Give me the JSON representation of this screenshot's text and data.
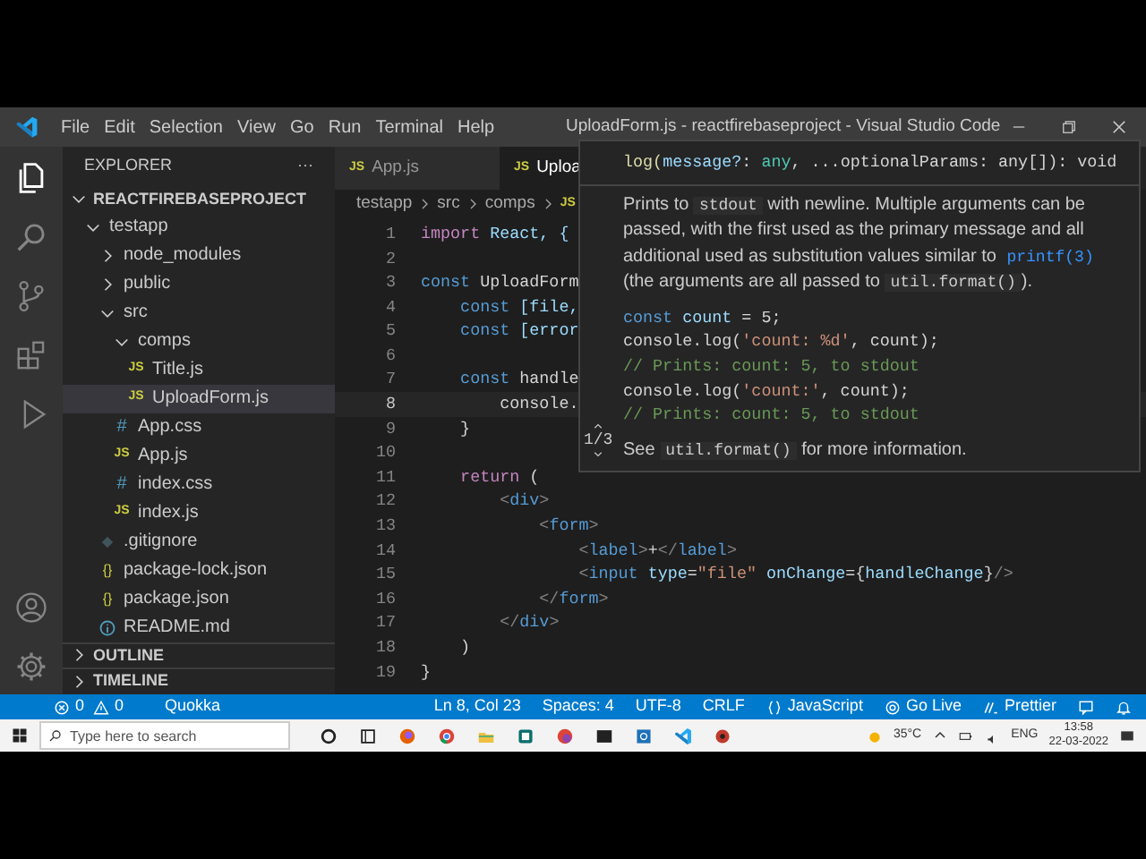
{
  "window": {
    "title": "UploadForm.js - reactfirebaseproject - Visual Studio Code"
  },
  "menu": [
    "File",
    "Edit",
    "Selection",
    "View",
    "Go",
    "Run",
    "Terminal",
    "Help"
  ],
  "activity_bar": [
    {
      "kind": "files",
      "selected": true
    },
    {
      "kind": "search",
      "selected": false
    },
    {
      "kind": "scm",
      "selected": false
    },
    {
      "kind": "extensions",
      "selected": false
    },
    {
      "kind": "run",
      "selected": false
    }
  ],
  "activity_bottom": [
    {
      "kind": "account"
    },
    {
      "kind": "settings"
    }
  ],
  "sidebar": {
    "title": "EXPLORER",
    "more": "···",
    "project": "REACTFIREBASEPROJECT",
    "tree": [
      {
        "label": "testapp",
        "kind": "folder",
        "expanded": true,
        "selected": false,
        "children": [
          {
            "label": "node_modules",
            "kind": "folder",
            "expanded": false,
            "selected": false
          },
          {
            "label": "public",
            "kind": "folder",
            "expanded": false,
            "selected": false
          },
          {
            "label": "src",
            "kind": "folder",
            "expanded": true,
            "selected": false,
            "children": [
              {
                "label": "comps",
                "kind": "folder",
                "expanded": true,
                "selected": false,
                "children": [
                  {
                    "label": "Title.js",
                    "kind": "js",
                    "icon_text": "JS",
                    "selected": false
                  },
                  {
                    "label": "UploadForm.js",
                    "kind": "js",
                    "icon_text": "JS",
                    "selected": true
                  }
                ]
              },
              {
                "label": "App.css",
                "kind": "css",
                "icon_text": "#",
                "selected": false
              },
              {
                "label": "App.js",
                "kind": "js",
                "icon_text": "JS",
                "selected": false
              },
              {
                "label": "index.css",
                "kind": "css",
                "icon_text": "#",
                "selected": false
              },
              {
                "label": "index.js",
                "kind": "js",
                "icon_text": "JS",
                "selected": false
              }
            ]
          },
          {
            "label": ".gitignore",
            "kind": "git",
            "selected": false
          },
          {
            "label": "package-lock.json",
            "kind": "json",
            "icon_text": "{}",
            "selected": false
          },
          {
            "label": "package.json",
            "kind": "json",
            "icon_text": "{}",
            "selected": false
          },
          {
            "label": "README.md",
            "kind": "info",
            "selected": false
          }
        ]
      }
    ],
    "sections": [
      {
        "label": "OUTLINE",
        "expanded": false
      },
      {
        "label": "TIMELINE",
        "expanded": false
      }
    ]
  },
  "tabs": [
    {
      "label": "App.js",
      "icon_text": "JS",
      "selected": false
    },
    {
      "label": "Uploa",
      "icon_text": "JS",
      "selected": true
    }
  ],
  "breadcrumb": [
    "testapp",
    "src",
    "comps"
  ],
  "breadcrumb_icon": "JS",
  "code_lines": [
    {
      "number": "1",
      "current": false,
      "tokens": [
        {
          "kind": "ctrl",
          "text": "import"
        },
        {
          "kind": "var",
          "text": " React, {"
        }
      ]
    },
    {
      "number": "2",
      "current": false
    },
    {
      "number": "3",
      "current": false,
      "tokens": [
        {
          "kind": "kw",
          "text": "const"
        },
        {
          "kind": "plain",
          "text": " UploadForm"
        }
      ]
    },
    {
      "number": "4",
      "current": false,
      "tokens": [
        {
          "kind": "kw",
          "text": "    const"
        },
        {
          "kind": "var",
          "text": " [file,"
        }
      ]
    },
    {
      "number": "5",
      "current": false,
      "tokens": [
        {
          "kind": "kw",
          "text": "    const"
        },
        {
          "kind": "var",
          "text": " [error"
        }
      ]
    },
    {
      "number": "6",
      "current": false
    },
    {
      "number": "7",
      "current": false,
      "tokens": [
        {
          "kind": "kw",
          "text": "    const"
        },
        {
          "kind": "plain",
          "text": " handle"
        }
      ]
    },
    {
      "number": "8",
      "current": true,
      "tokens": [
        {
          "kind": "plain",
          "text": "        console."
        }
      ]
    },
    {
      "number": "9",
      "current": false,
      "tokens": [
        {
          "kind": "plain",
          "text": "    }"
        }
      ]
    },
    {
      "number": "10",
      "current": false
    },
    {
      "number": "11",
      "current": false,
      "tokens": [
        {
          "kind": "ctrl",
          "text": "    return"
        },
        {
          "kind": "plain",
          "text": " ("
        }
      ]
    },
    {
      "number": "12",
      "current": false,
      "tokens": [
        {
          "kind": "punct",
          "text": "        <"
        },
        {
          "kind": "tag",
          "text": "div"
        },
        {
          "kind": "punct",
          "text": ">"
        }
      ]
    },
    {
      "number": "13",
      "current": false,
      "tokens": [
        {
          "kind": "punct",
          "text": "            <"
        },
        {
          "kind": "tag",
          "text": "form"
        },
        {
          "kind": "punct",
          "text": ">"
        }
      ]
    },
    {
      "number": "14",
      "current": false,
      "tokens": [
        {
          "kind": "punct",
          "text": "                <"
        },
        {
          "kind": "tag",
          "text": "label"
        },
        {
          "kind": "punct",
          "text": ">"
        },
        {
          "kind": "plain",
          "text": "+"
        },
        {
          "kind": "punct",
          "text": "</"
        },
        {
          "kind": "tag",
          "text": "label"
        },
        {
          "kind": "punct",
          "text": ">"
        }
      ]
    },
    {
      "number": "15",
      "current": false,
      "tokens": [
        {
          "kind": "punct",
          "text": "                <"
        },
        {
          "kind": "tag",
          "text": "input"
        },
        {
          "kind": "var",
          "text": " type"
        },
        {
          "kind": "plain",
          "text": "="
        },
        {
          "kind": "str",
          "text": "\"file\""
        },
        {
          "kind": "var",
          "text": " onChange"
        },
        {
          "kind": "plain",
          "text": "={"
        },
        {
          "kind": "var",
          "text": "handleChange"
        },
        {
          "kind": "plain",
          "text": "}"
        },
        {
          "kind": "punct",
          "text": "/>"
        }
      ]
    },
    {
      "number": "16",
      "current": false,
      "tokens": [
        {
          "kind": "punct",
          "text": "            </"
        },
        {
          "kind": "tag",
          "text": "form"
        },
        {
          "kind": "punct",
          "text": ">"
        }
      ]
    },
    {
      "number": "17",
      "current": false,
      "tokens": [
        {
          "kind": "punct",
          "text": "        </"
        },
        {
          "kind": "tag",
          "text": "div"
        },
        {
          "kind": "punct",
          "text": ">"
        }
      ]
    },
    {
      "number": "18",
      "current": false,
      "tokens": [
        {
          "kind": "plain",
          "text": "    )"
        }
      ]
    },
    {
      "number": "19",
      "current": false,
      "tokens": [
        {
          "kind": "plain",
          "text": "}"
        }
      ]
    }
  ],
  "hover": {
    "signature": [
      {
        "kind": "func",
        "text": "log("
      },
      {
        "kind": "param",
        "text": "message?"
      },
      {
        "kind": "plain",
        "text": ": "
      },
      {
        "kind": "type",
        "text": "any"
      },
      {
        "kind": "plain",
        "text": ", ...optionalParams: any[]): void"
      }
    ],
    "description": [
      {
        "kind": "text",
        "text": "Prints to "
      },
      {
        "kind": "code",
        "text": "stdout"
      },
      {
        "kind": "text",
        "text": " with newline. Multiple arguments can be passed, with the first used as the primary message and all additional used as substitution values similar to "
      },
      {
        "kind": "link",
        "text": "printf(3)"
      },
      {
        "kind": "text",
        "text": " (the arguments are all passed to "
      },
      {
        "kind": "code",
        "text": "util.format()"
      },
      {
        "kind": "text",
        "text": ")."
      }
    ],
    "example": [
      [
        {
          "kind": "kw",
          "text": "const"
        },
        {
          "kind": "var",
          "text": " count"
        },
        {
          "kind": "plain",
          "text": " = 5;"
        }
      ],
      [
        {
          "kind": "plain",
          "text": "console.log("
        },
        {
          "kind": "str",
          "text": "'count: %d'"
        },
        {
          "kind": "plain",
          "text": ", count);"
        }
      ],
      [
        {
          "kind": "comment",
          "text": "// Prints: count: 5, to stdout"
        }
      ],
      [
        {
          "kind": "plain",
          "text": "console.log("
        },
        {
          "kind": "str",
          "text": "'count:'"
        },
        {
          "kind": "plain",
          "text": ", count);"
        }
      ],
      [
        {
          "kind": "comment",
          "text": "// Prints: count: 5, to stdout"
        }
      ]
    ],
    "footer": [
      {
        "kind": "text",
        "text": "See "
      },
      {
        "kind": "code",
        "text": "util.format()"
      },
      {
        "kind": "text",
        "text": " for more information."
      }
    ],
    "overload": "1/3"
  },
  "status_bar": {
    "left": [
      {
        "kind": "errors",
        "text": "0"
      },
      {
        "kind": "warnings",
        "text": "0"
      },
      {
        "kind": "text",
        "text": "Quokka"
      }
    ],
    "right": [
      {
        "kind": "text",
        "text": "Ln 8, Col 23"
      },
      {
        "kind": "text",
        "text": "Spaces: 4"
      },
      {
        "kind": "text",
        "text": "UTF-8"
      },
      {
        "kind": "text",
        "text": "CRLF"
      },
      {
        "kind": "lang",
        "text": "JavaScript"
      },
      {
        "kind": "golive",
        "text": "Go Live"
      },
      {
        "kind": "prettier",
        "text": "Prettier"
      },
      {
        "kind": "feedback"
      },
      {
        "kind": "bell"
      }
    ]
  },
  "taskbar": {
    "search_placeholder": "Type here to search",
    "apps": [
      {
        "kind": "cortana"
      },
      {
        "kind": "taskview"
      },
      {
        "kind": "firefox"
      },
      {
        "kind": "chrome"
      },
      {
        "kind": "files"
      },
      {
        "kind": "app"
      },
      {
        "kind": "chrome2"
      },
      {
        "kind": "terminal"
      },
      {
        "kind": "settings"
      },
      {
        "kind": "vscode"
      },
      {
        "kind": "recorder"
      }
    ],
    "weather": "35°C",
    "language": "ENG",
    "time": "13:58",
    "date": "22-03-2022"
  }
}
